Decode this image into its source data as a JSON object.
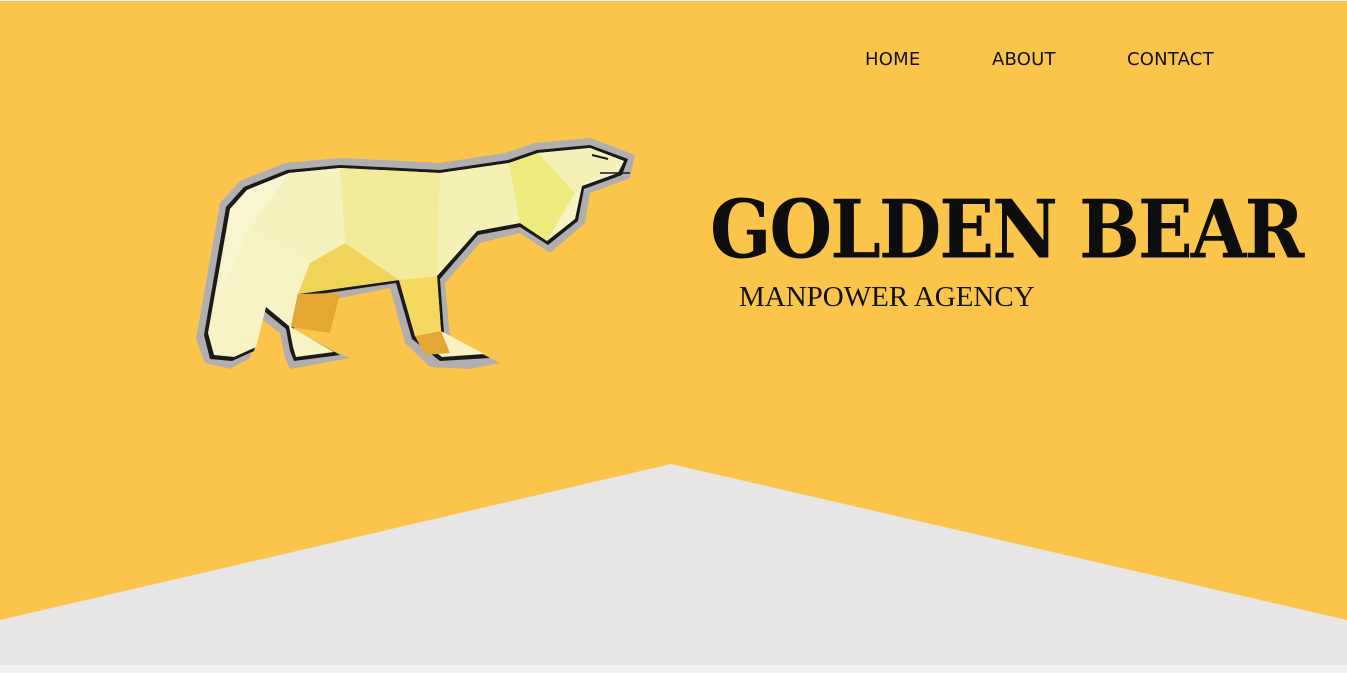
{
  "nav": {
    "items": [
      {
        "label": "HOME"
      },
      {
        "label": "ABOUT"
      },
      {
        "label": "CONTACT"
      }
    ]
  },
  "brand": {
    "title": "GOLDEN BEAR",
    "subtitle": "MANPOWER AGENCY",
    "logo_icon": "polar-bear-icon"
  },
  "colors": {
    "background": "#fbc54b",
    "chevron": "#e8e5e5",
    "text": "#111111"
  }
}
